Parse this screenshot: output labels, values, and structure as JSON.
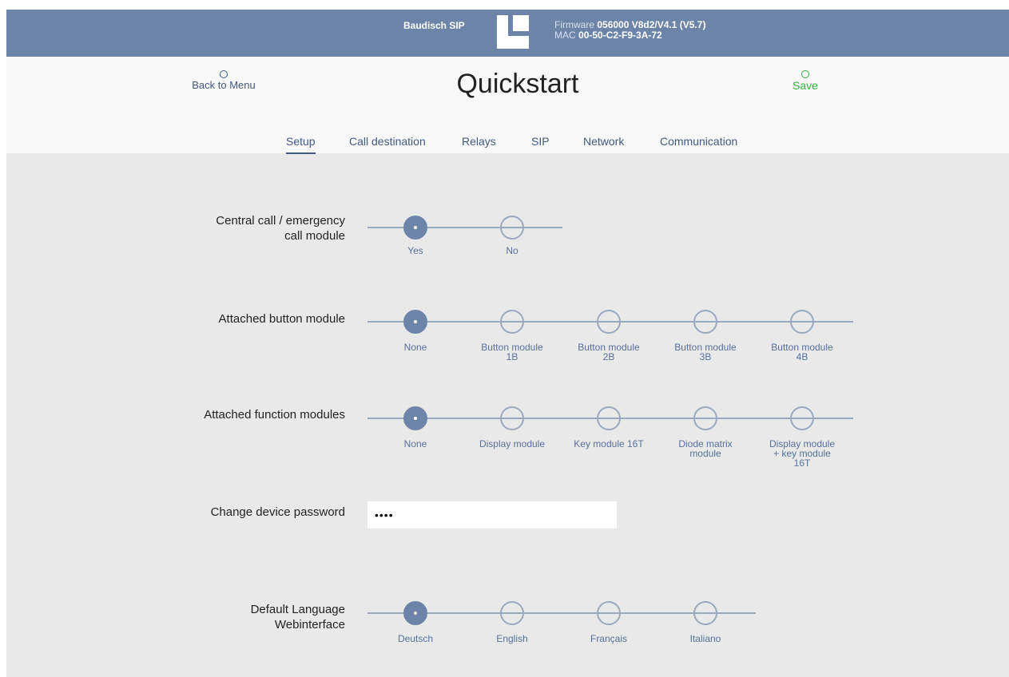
{
  "topbar": {
    "brand": "Baudisch SIP",
    "firmware_label": "Firmware",
    "firmware_value": "056000 V8d2/V4.1 (V5.7)",
    "mac_label": "MAC",
    "mac_value": "00-50-C2-F9-3A-72",
    "color": "#6c84a8"
  },
  "header": {
    "back_label": "Back to Menu",
    "title": "Quickstart",
    "save_label": "Save",
    "save_color": "#2eb33a"
  },
  "tabs": [
    {
      "label": "Setup",
      "active": true
    },
    {
      "label": "Call destination"
    },
    {
      "label": "Relays"
    },
    {
      "label": "SIP"
    },
    {
      "label": "Network"
    },
    {
      "label": "Communication"
    }
  ],
  "settings": {
    "central_call": {
      "label_line1": "Central call / emergency",
      "label_line2": "call module",
      "options": [
        "Yes",
        "No"
      ],
      "selected": "Yes"
    },
    "button_module": {
      "label": "Attached button module",
      "options": [
        "None",
        "Button module 1B",
        "Button module 2B",
        "Button module 3B",
        "Button module 4B"
      ],
      "selected": "None"
    },
    "function_modules": {
      "label": "Attached function modules",
      "options": [
        "None",
        "Display module",
        "Key module 16T",
        "Diode matrix module",
        "Display module + key module 16T"
      ],
      "selected": "None"
    },
    "password": {
      "label": "Change device password",
      "value": "••••"
    },
    "language": {
      "label_line1": "Default Language",
      "label_line2": "Webinterface",
      "options": [
        "Deutsch",
        "English",
        "Français",
        "Italiano"
      ],
      "selected": "Deutsch"
    }
  }
}
